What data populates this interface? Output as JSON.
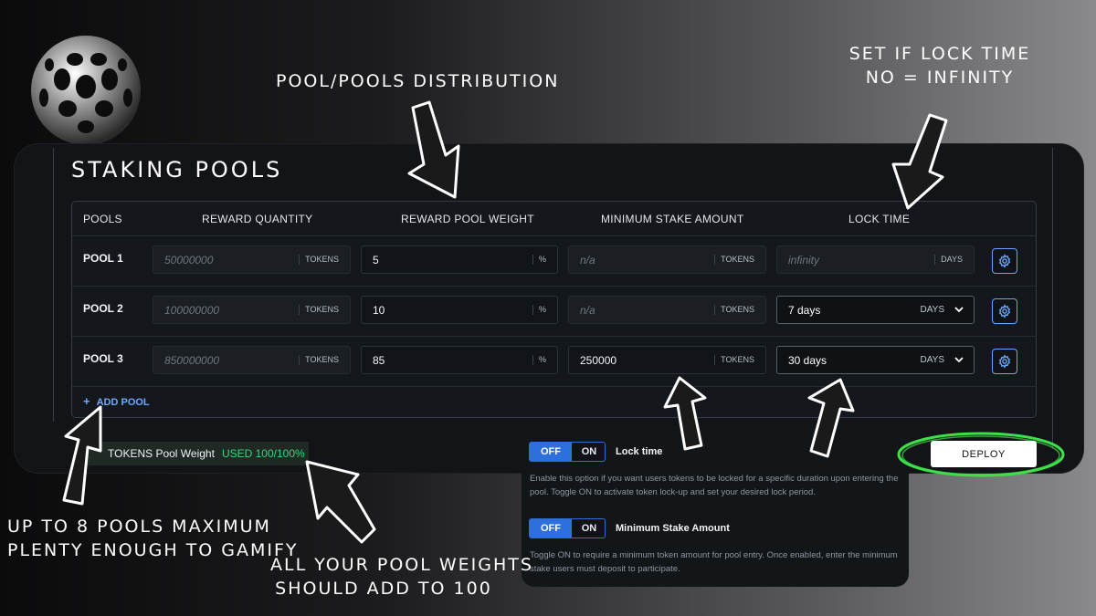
{
  "annotations": {
    "pool_distribution": "POOL/POOLS DISTRIBUTION",
    "lock_time_line1": "SET IF LOCK TIME",
    "lock_time_line2": "NO = INFINITY",
    "max_pools_line1": "UP TO 8 POOLS MAXIMUM",
    "max_pools_line2": "PLENTY ENOUGH TO GAMIFY",
    "weights_line1": "ALL YOUR POOL WEIGHTS",
    "weights_line2": "SHOULD ADD TO 100"
  },
  "panel": {
    "title": "STAKING POOLS",
    "columns": {
      "pools": "POOLS",
      "reward_quantity": "REWARD QUANTITY",
      "reward_pool_weight": "REWARD POOL WEIGHT",
      "minimum_stake_amount": "MINIMUM STAKE AMOUNT",
      "lock_time": "LOCK TIME"
    },
    "rows": [
      {
        "name": "POOL 1",
        "reward_quantity": "50000000",
        "reward_unit": "TOKENS",
        "weight": "5",
        "weight_unit": "%",
        "min_stake": "n/a",
        "min_stake_unit": "TOKENS",
        "lock": "infinity",
        "lock_unit": "DAYS"
      },
      {
        "name": "POOL 2",
        "reward_quantity": "100000000",
        "reward_unit": "TOKENS",
        "weight": "10",
        "weight_unit": "%",
        "min_stake": "n/a",
        "min_stake_unit": "TOKENS",
        "lock": "7 days",
        "lock_unit": "DAYS"
      },
      {
        "name": "POOL 3",
        "reward_quantity": "850000000",
        "reward_unit": "TOKENS",
        "weight": "85",
        "weight_unit": "%",
        "min_stake": "250000",
        "min_stake_unit": "TOKENS",
        "lock": "30 days",
        "lock_unit": "DAYS"
      }
    ],
    "add_pool_label": "ADD POOL",
    "weight_label": "TOKENS Pool Weight",
    "weight_used": "USED 100/100%",
    "deploy_label": "DEPLOY"
  },
  "toggles": [
    {
      "off_label": "OFF",
      "on_label": "ON",
      "label": "Lock time",
      "description": "Enable this option if you want users tokens to be locked for a specific duration upon entering the pool. Toggle ON to activate token lock-up and set your desired lock period."
    },
    {
      "off_label": "OFF",
      "on_label": "ON",
      "label": "Minimum Stake Amount",
      "description": "Toggle ON to require a minimum token amount for pool entry. Once enabled, enter the minimum stake users must deposit to participate."
    }
  ],
  "colors": {
    "accent_blue": "#2e6fde",
    "link_blue": "#6ea8ff",
    "success_green": "#42d17f",
    "highlight_ring": "#3ee04a"
  }
}
